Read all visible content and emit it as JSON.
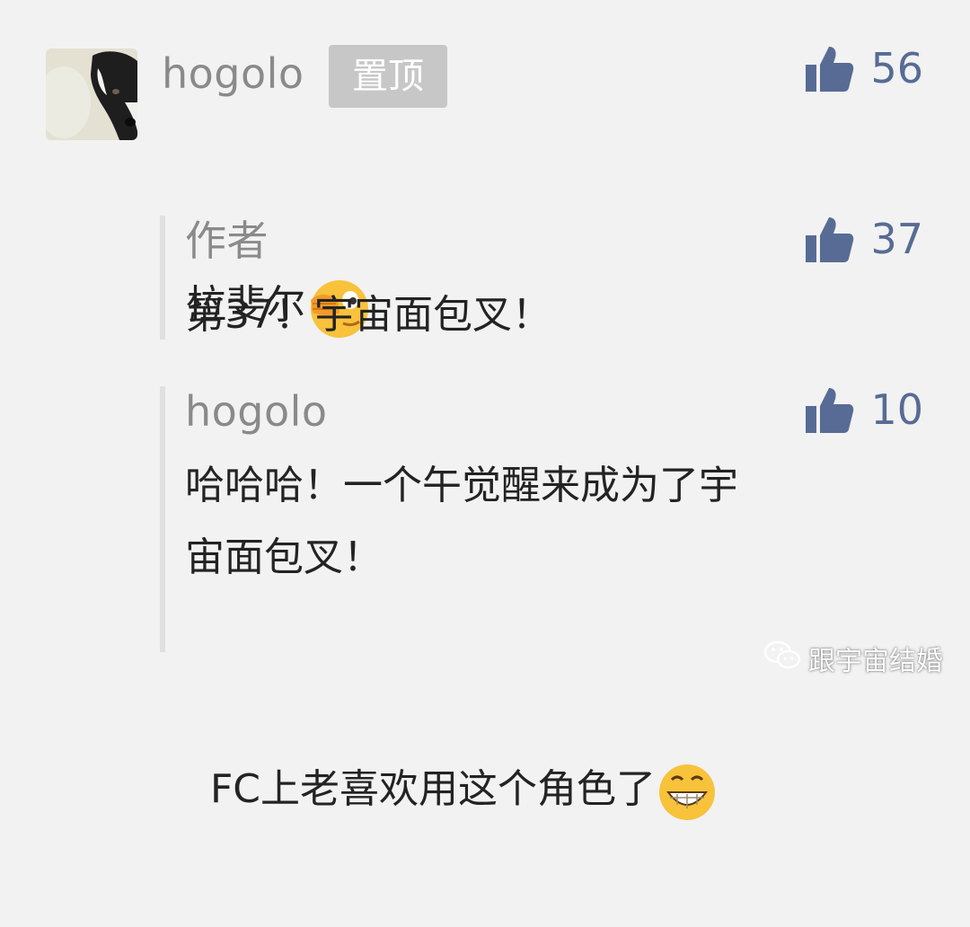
{
  "comments": [
    {
      "author": "hogolo",
      "badge": "置顶",
      "likes": "56",
      "text": "拉斐尔",
      "emoji": "face-covering-eye-emoji"
    },
    {
      "author": "作者",
      "likes": "37",
      "text": "第37！宇宙面包叉！"
    },
    {
      "author": "hogolo",
      "likes": "10",
      "lines": [
        "哈哈哈！一个午觉醒来成为了宇",
        "宙面包叉！",
        "FC上老喜欢用这个角色了"
      ],
      "emoji": "grinning-face-emoji"
    }
  ],
  "watermark": "跟宇宙结婚",
  "colors": {
    "accent": "#576b95",
    "background": "#f2f2f2",
    "name": "#8a8a8a",
    "text": "#232323",
    "badge": "#c7c7c7"
  },
  "icons": {
    "like": "thumbs-up-icon",
    "watermark": "wechat-icon"
  }
}
